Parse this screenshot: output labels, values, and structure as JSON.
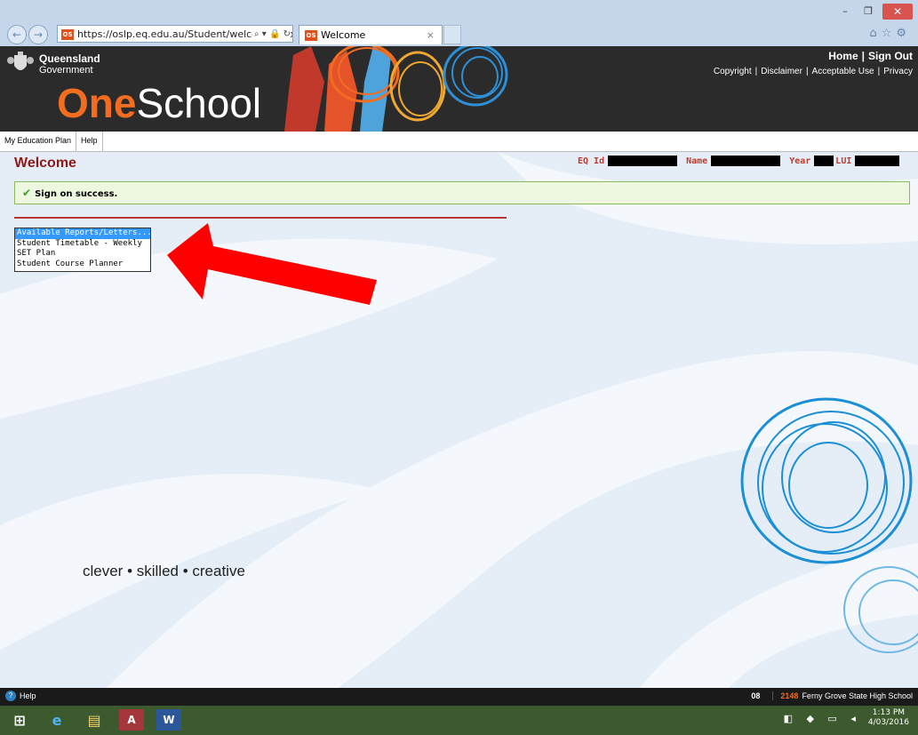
{
  "browser": {
    "url": "https://oslp.eq.edu.au/Student/welcome.aspx",
    "tab_title": "Welcome",
    "favicon_text": "OS"
  },
  "header": {
    "gov_line1": "Queensland",
    "gov_line2": "Government",
    "brand_one": "One",
    "brand_school": "School",
    "home": "Home",
    "sign_out": "Sign Out",
    "links": [
      "Copyright",
      "Disclaimer",
      "Acceptable Use",
      "Privacy"
    ]
  },
  "menu": {
    "items": [
      "My Education Plan",
      "Help"
    ]
  },
  "page": {
    "title": "Welcome",
    "id_labels": {
      "eq_id": "EQ Id",
      "name": "Name",
      "year": "Year",
      "lui": "LUI"
    },
    "success_message": "Sign on success.",
    "reports": {
      "options": [
        "Available Reports/Letters...",
        "Student Timetable - Weekly",
        "SET Plan",
        "Student Course Planner"
      ],
      "selected": "Available Reports/Letters..."
    },
    "tagline": "clever • skilled • creative"
  },
  "statusbar": {
    "help": "Help",
    "code": "08",
    "school_number": "2148",
    "school_name": "Ferny Grove State High School"
  },
  "taskbar": {
    "time": "1:13 PM",
    "date": "4/03/2016"
  },
  "colors": {
    "brand_orange": "#f36d21",
    "title_red": "#8b1a1a",
    "success_bg": "#eef7df",
    "highlight_blue": "#3399ff"
  }
}
